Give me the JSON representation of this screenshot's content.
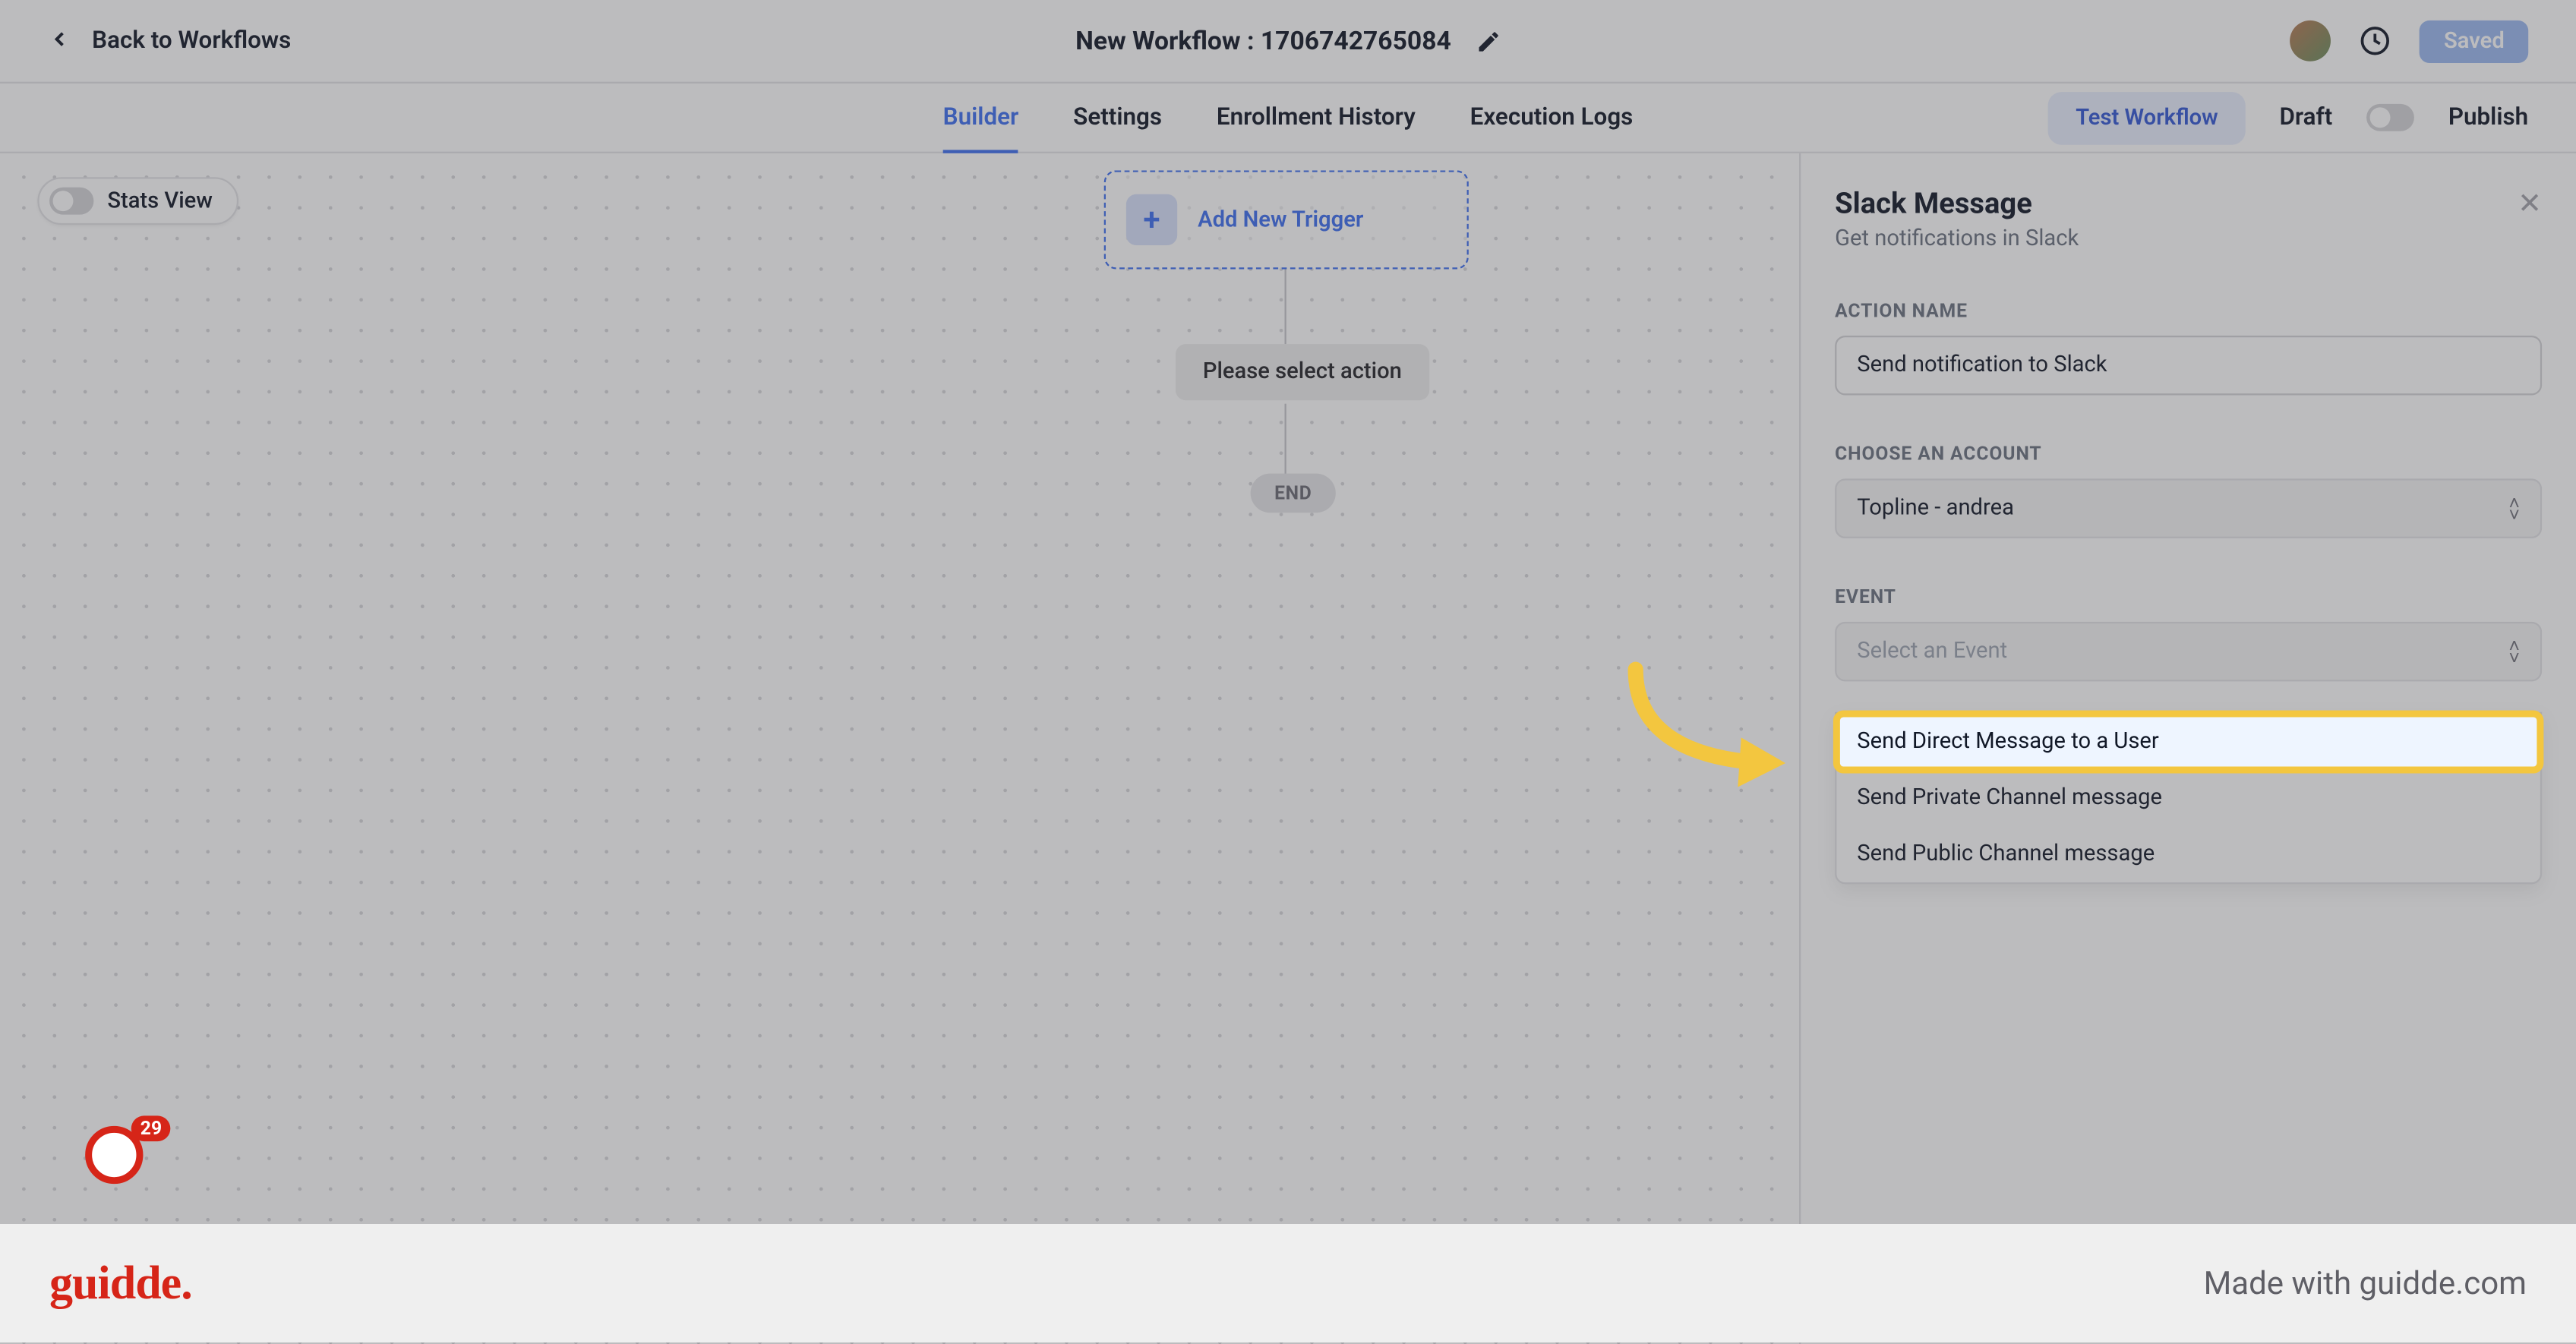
{
  "header": {
    "back_label": "Back to Workflows",
    "title": "New Workflow : 1706742765084",
    "saved_label": "Saved"
  },
  "tabs": {
    "builder": "Builder",
    "settings": "Settings",
    "enrollment": "Enrollment History",
    "logs": "Execution Logs",
    "test_label": "Test Workflow",
    "draft": "Draft",
    "publish": "Publish"
  },
  "canvas": {
    "stats_label": "Stats View",
    "trigger_label": "Add New Trigger",
    "select_action_label": "Please select action",
    "end_label": "END"
  },
  "panel": {
    "title": "Slack Message",
    "subtitle": "Get notifications in Slack",
    "action_name_label": "ACTION NAME",
    "action_name_value": "Send notification to Slack",
    "choose_account_label": "CHOOSE AN ACCOUNT",
    "account_value": "Topline - andrea",
    "event_label": "EVENT",
    "event_placeholder": "Select an Event",
    "dropdown_items": {
      "dm": "Send Direct Message to a User",
      "private": "Send Private Channel message",
      "public": "Send Public Channel message"
    }
  },
  "badge": {
    "count": "29"
  },
  "footer": {
    "logo": "guidde",
    "made_with": "Made with guidde.com"
  }
}
